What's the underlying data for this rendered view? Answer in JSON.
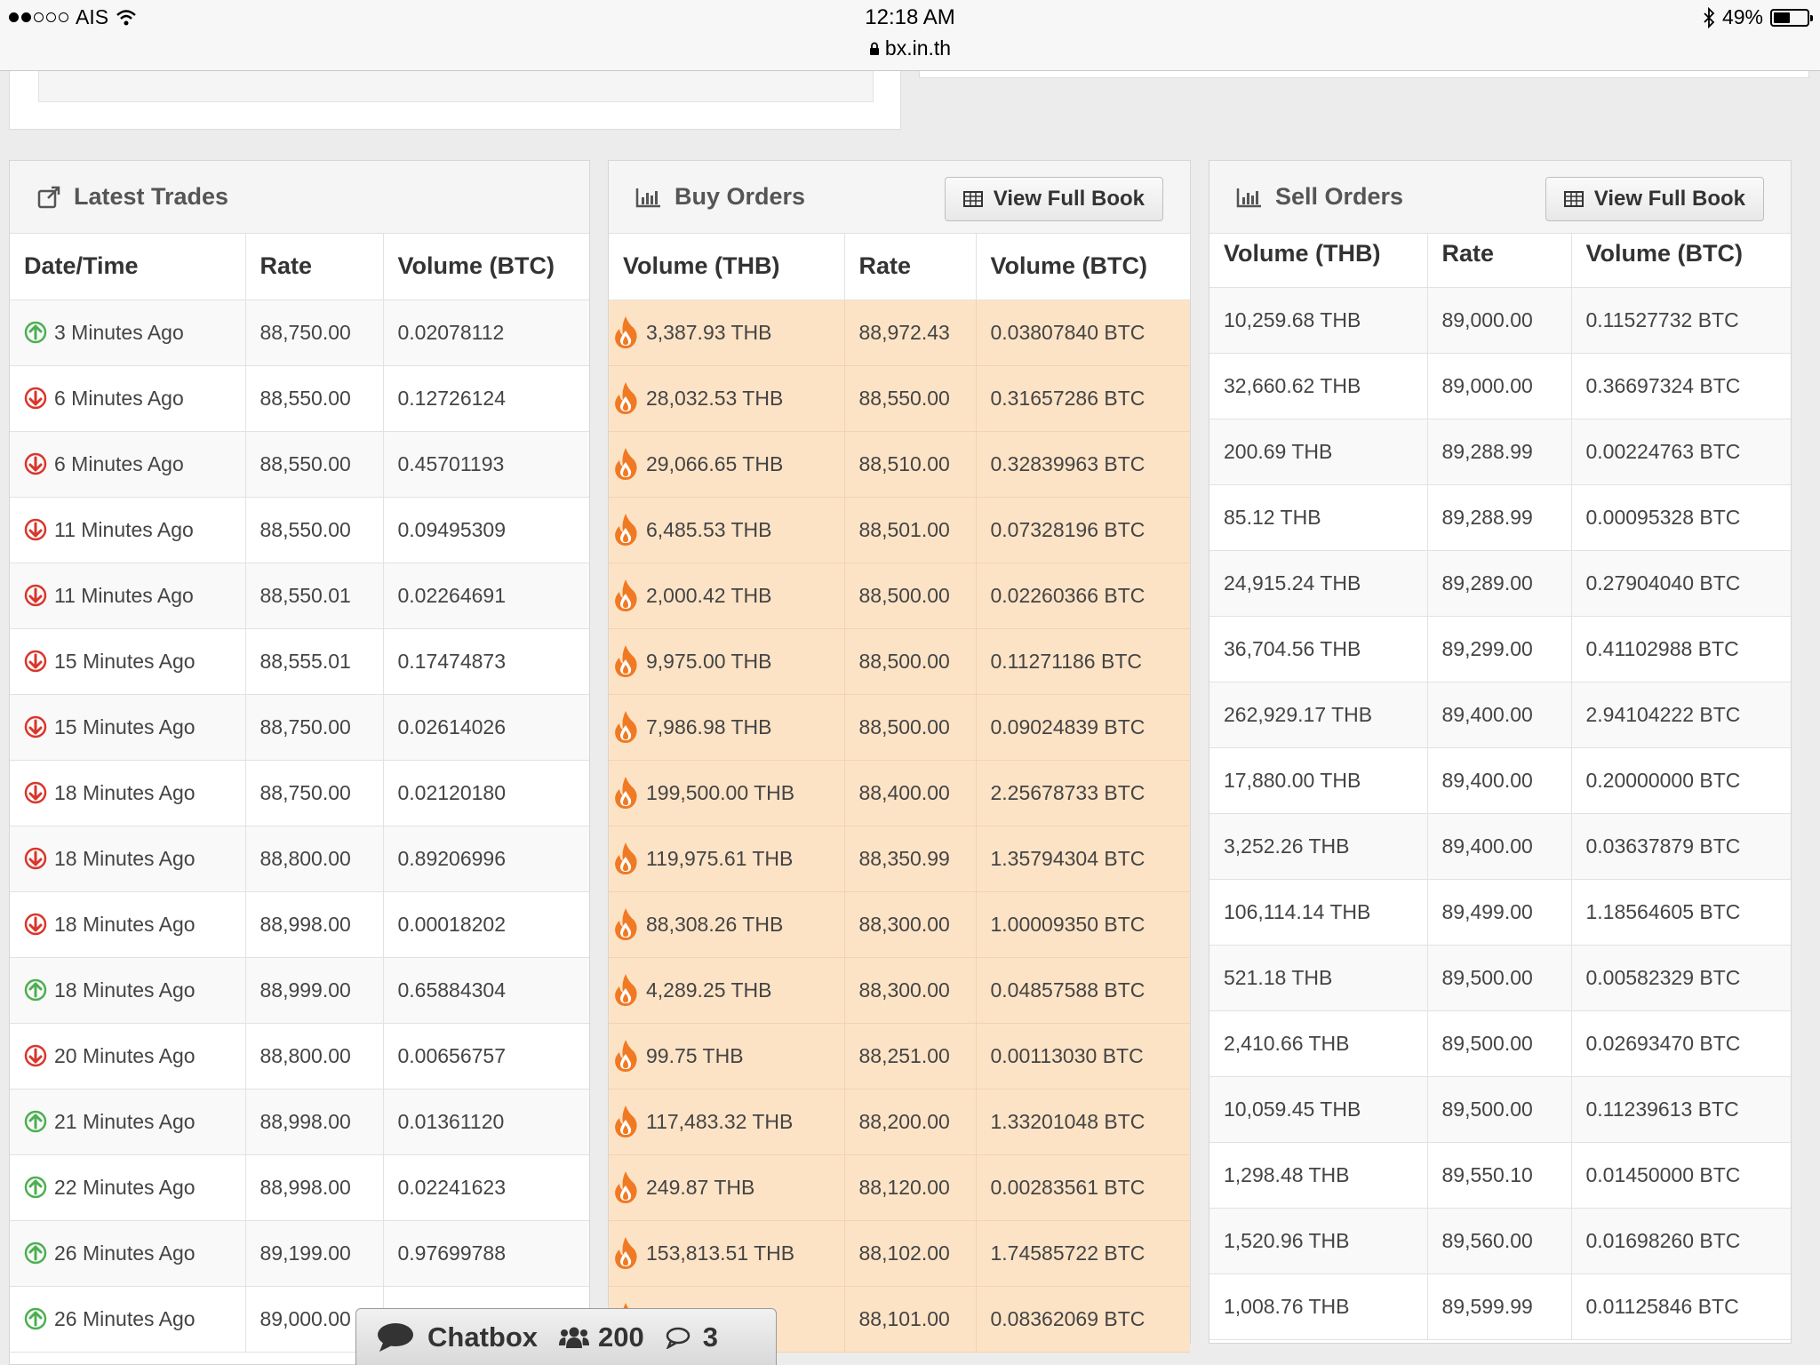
{
  "status": {
    "carrier": "AIS",
    "time": "12:18 AM",
    "url": "bx.in.th",
    "battery": "49%",
    "battery_level": 0.49
  },
  "latest_trades": {
    "title": "Latest Trades",
    "columns": [
      "Date/Time",
      "Rate",
      "Volume (BTC)"
    ],
    "rows": [
      {
        "dir": "up",
        "time": "3 Minutes Ago",
        "rate": "88,750.00",
        "volume": "0.02078112"
      },
      {
        "dir": "down",
        "time": "6 Minutes Ago",
        "rate": "88,550.00",
        "volume": "0.12726124"
      },
      {
        "dir": "down",
        "time": "6 Minutes Ago",
        "rate": "88,550.00",
        "volume": "0.45701193"
      },
      {
        "dir": "down",
        "time": "11 Minutes Ago",
        "rate": "88,550.00",
        "volume": "0.09495309"
      },
      {
        "dir": "down",
        "time": "11 Minutes Ago",
        "rate": "88,550.01",
        "volume": "0.02264691"
      },
      {
        "dir": "down",
        "time": "15 Minutes Ago",
        "rate": "88,555.01",
        "volume": "0.17474873"
      },
      {
        "dir": "down",
        "time": "15 Minutes Ago",
        "rate": "88,750.00",
        "volume": "0.02614026"
      },
      {
        "dir": "down",
        "time": "18 Minutes Ago",
        "rate": "88,750.00",
        "volume": "0.02120180"
      },
      {
        "dir": "down",
        "time": "18 Minutes Ago",
        "rate": "88,800.00",
        "volume": "0.89206996"
      },
      {
        "dir": "down",
        "time": "18 Minutes Ago",
        "rate": "88,998.00",
        "volume": "0.00018202"
      },
      {
        "dir": "up",
        "time": "18 Minutes Ago",
        "rate": "88,999.00",
        "volume": "0.65884304"
      },
      {
        "dir": "down",
        "time": "20 Minutes Ago",
        "rate": "88,800.00",
        "volume": "0.00656757"
      },
      {
        "dir": "up",
        "time": "21 Minutes Ago",
        "rate": "88,998.00",
        "volume": "0.01361120"
      },
      {
        "dir": "up",
        "time": "22 Minutes Ago",
        "rate": "88,998.00",
        "volume": "0.02241623"
      },
      {
        "dir": "up",
        "time": "26 Minutes Ago",
        "rate": "89,199.00",
        "volume": "0.97699788"
      },
      {
        "dir": "up",
        "time": "26 Minutes Ago",
        "rate": "89,000.00",
        "volume": ""
      }
    ]
  },
  "buy_orders": {
    "title": "Buy Orders",
    "button": "View Full Book",
    "columns": [
      "Volume (THB)",
      "Rate",
      "Volume (BTC)"
    ],
    "rows": [
      {
        "thb": "3,387.93 THB",
        "rate": "88,972.43",
        "btc": "0.03807840 BTC"
      },
      {
        "thb": "28,032.53 THB",
        "rate": "88,550.00",
        "btc": "0.31657286 BTC"
      },
      {
        "thb": "29,066.65 THB",
        "rate": "88,510.00",
        "btc": "0.32839963 BTC"
      },
      {
        "thb": "6,485.53 THB",
        "rate": "88,501.00",
        "btc": "0.07328196 BTC"
      },
      {
        "thb": "2,000.42 THB",
        "rate": "88,500.00",
        "btc": "0.02260366 BTC"
      },
      {
        "thb": "9,975.00 THB",
        "rate": "88,500.00",
        "btc": "0.11271186 BTC"
      },
      {
        "thb": "7,986.98 THB",
        "rate": "88,500.00",
        "btc": "0.09024839 BTC"
      },
      {
        "thb": "199,500.00 THB",
        "rate": "88,400.00",
        "btc": "2.25678733 BTC"
      },
      {
        "thb": "119,975.61 THB",
        "rate": "88,350.99",
        "btc": "1.35794304 BTC"
      },
      {
        "thb": "88,308.26 THB",
        "rate": "88,300.00",
        "btc": "1.00009350 BTC"
      },
      {
        "thb": "4,289.25 THB",
        "rate": "88,300.00",
        "btc": "0.04857588 BTC"
      },
      {
        "thb": "99.75 THB",
        "rate": "88,251.00",
        "btc": "0.00113030 BTC"
      },
      {
        "thb": "117,483.32 THB",
        "rate": "88,200.00",
        "btc": "1.33201048 BTC"
      },
      {
        "thb": "249.87 THB",
        "rate": "88,120.00",
        "btc": "0.00283561 BTC"
      },
      {
        "thb": "153,813.51 THB",
        "rate": "88,102.00",
        "btc": "1.74585722 BTC"
      },
      {
        "thb": "",
        "rate": "88,101.00",
        "btc": "0.08362069 BTC"
      }
    ]
  },
  "sell_orders": {
    "title": "Sell Orders",
    "button": "View Full Book",
    "columns": [
      "Volume (THB)",
      "Rate",
      "Volume (BTC)"
    ],
    "rows": [
      {
        "thb": "10,259.68 THB",
        "rate": "89,000.00",
        "btc": "0.11527732 BTC"
      },
      {
        "thb": "32,660.62 THB",
        "rate": "89,000.00",
        "btc": "0.36697324 BTC"
      },
      {
        "thb": "200.69 THB",
        "rate": "89,288.99",
        "btc": "0.00224763 BTC"
      },
      {
        "thb": "85.12 THB",
        "rate": "89,288.99",
        "btc": "0.00095328 BTC"
      },
      {
        "thb": "24,915.24 THB",
        "rate": "89,289.00",
        "btc": "0.27904040 BTC"
      },
      {
        "thb": "36,704.56 THB",
        "rate": "89,299.00",
        "btc": "0.41102988 BTC"
      },
      {
        "thb": "262,929.17 THB",
        "rate": "89,400.00",
        "btc": "2.94104222 BTC"
      },
      {
        "thb": "17,880.00 THB",
        "rate": "89,400.00",
        "btc": "0.20000000 BTC"
      },
      {
        "thb": "3,252.26 THB",
        "rate": "89,400.00",
        "btc": "0.03637879 BTC"
      },
      {
        "thb": "106,114.14 THB",
        "rate": "89,499.00",
        "btc": "1.18564605 BTC"
      },
      {
        "thb": "521.18 THB",
        "rate": "89,500.00",
        "btc": "0.00582329 BTC"
      },
      {
        "thb": "2,410.66 THB",
        "rate": "89,500.00",
        "btc": "0.02693470 BTC"
      },
      {
        "thb": "10,059.45 THB",
        "rate": "89,500.00",
        "btc": "0.11239613 BTC"
      },
      {
        "thb": "1,298.48 THB",
        "rate": "89,550.10",
        "btc": "0.01450000 BTC"
      },
      {
        "thb": "1,520.96 THB",
        "rate": "89,560.00",
        "btc": "0.01698260 BTC"
      },
      {
        "thb": "1,008.76 THB",
        "rate": "89,599.99",
        "btc": "0.01125846 BTC"
      }
    ]
  },
  "chatbox": {
    "label": "Chatbox",
    "users": "200",
    "messages": "3"
  },
  "colors": {
    "up": "#4caf50",
    "down": "#d9362b",
    "buy_row": "#fde3c6",
    "flame": "#f07a24"
  }
}
